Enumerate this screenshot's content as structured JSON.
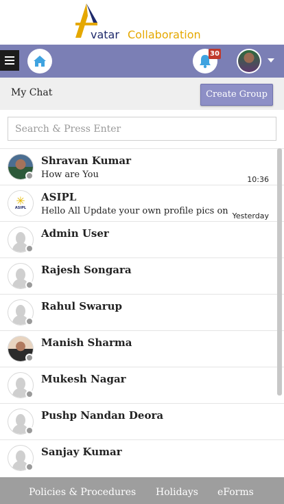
{
  "app": {
    "logo_text_1": "vatar",
    "logo_text_2": "Collaboration"
  },
  "navbar": {
    "notification_count": "30"
  },
  "chat_header": {
    "title": "My Chat",
    "create_group_label": "Create Group"
  },
  "search": {
    "placeholder": "Search & Press Enter",
    "value": ""
  },
  "chats": [
    {
      "name": "Shravan Kumar",
      "message": "How are You",
      "time": "10:36",
      "avatar": "photo"
    },
    {
      "name": "ASIPL",
      "message": "Hello All Update your own profile pics on be...",
      "time": "Yesterday",
      "avatar": "logo"
    },
    {
      "name": "Admin User",
      "message": "",
      "time": "",
      "avatar": "placeholder"
    },
    {
      "name": "Rajesh Songara",
      "message": "",
      "time": "",
      "avatar": "placeholder"
    },
    {
      "name": "Rahul Swarup",
      "message": "",
      "time": "",
      "avatar": "placeholder"
    },
    {
      "name": "Manish Sharma",
      "message": "",
      "time": "",
      "avatar": "photo"
    },
    {
      "name": "Mukesh Nagar",
      "message": "",
      "time": "",
      "avatar": "placeholder"
    },
    {
      "name": "Pushp Nandan Deora",
      "message": "",
      "time": "",
      "avatar": "placeholder"
    },
    {
      "name": "Sanjay Kumar",
      "message": "",
      "time": "",
      "avatar": "placeholder"
    }
  ],
  "footer": {
    "links": [
      "Policies & Procedures",
      "Holidays",
      "eForms"
    ]
  },
  "colors": {
    "navbar": "#7b7fb5",
    "button": "#8d8fc6",
    "badge": "#c0392b",
    "footer": "#9e9e9e"
  }
}
